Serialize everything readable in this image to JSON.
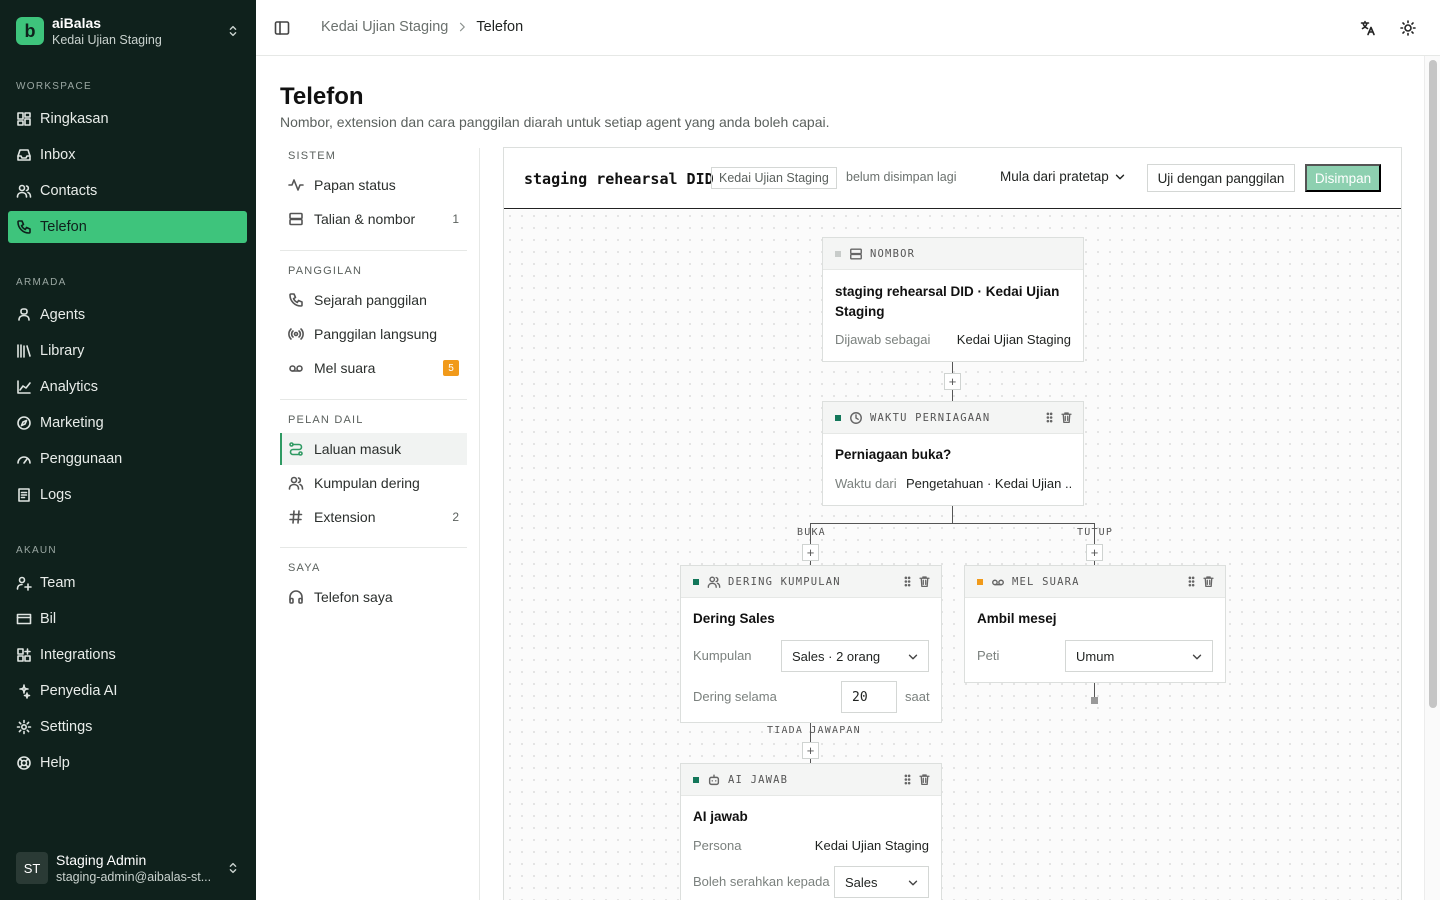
{
  "workspace": {
    "name": "aiBalas",
    "subtitle": "Kedai Ujian Staging",
    "logo_letter": "b"
  },
  "sidebar": {
    "sections": [
      {
        "title": "WORKSPACE",
        "items": [
          {
            "label": "Ringkasan",
            "icon": "dashboard-icon"
          },
          {
            "label": "Inbox",
            "icon": "inbox-icon"
          },
          {
            "label": "Contacts",
            "icon": "users-icon"
          },
          {
            "label": "Telefon",
            "icon": "phone-icon",
            "active": true
          }
        ]
      },
      {
        "title": "ARMADA",
        "items": [
          {
            "label": "Agents",
            "icon": "user-icon"
          },
          {
            "label": "Library",
            "icon": "library-icon"
          },
          {
            "label": "Analytics",
            "icon": "chart-icon"
          },
          {
            "label": "Marketing",
            "icon": "compass-icon"
          },
          {
            "label": "Penggunaan",
            "icon": "gauge-icon"
          },
          {
            "label": "Logs",
            "icon": "logs-icon"
          }
        ]
      },
      {
        "title": "AKAUN",
        "items": [
          {
            "label": "Team",
            "icon": "team-icon"
          },
          {
            "label": "Bil",
            "icon": "card-icon"
          },
          {
            "label": "Integrations",
            "icon": "puzzle-icon"
          },
          {
            "label": "Penyedia AI",
            "icon": "sparkle-icon"
          },
          {
            "label": "Settings",
            "icon": "gear-icon"
          },
          {
            "label": "Help",
            "icon": "lifebuoy-icon"
          }
        ]
      }
    ],
    "user": {
      "initials": "ST",
      "name": "Staging Admin",
      "email": "staging-admin@aibalas-st..."
    }
  },
  "topbar": {
    "crumb_parent": "Kedai Ujian Staging",
    "crumb_current": "Telefon"
  },
  "page": {
    "title": "Telefon",
    "subtitle": "Nombor, extension dan cara panggilan diarah untuk setiap agent yang anda boleh capai."
  },
  "subnav": {
    "sections": [
      {
        "title": "SISTEM",
        "items": [
          {
            "label": "Papan status",
            "icon": "activity-icon",
            "count": ""
          },
          {
            "label": "Talian & nombor",
            "icon": "server-icon",
            "count": "1"
          }
        ]
      },
      {
        "title": "PANGGILAN",
        "items": [
          {
            "label": "Sejarah panggilan",
            "icon": "phone-icon",
            "count": ""
          },
          {
            "label": "Panggilan langsung",
            "icon": "broadcast-icon",
            "count": ""
          },
          {
            "label": "Mel suara",
            "icon": "voicemail-icon",
            "badge": "5"
          }
        ]
      },
      {
        "title": "PELAN DAIL",
        "items": [
          {
            "label": "Laluan masuk",
            "icon": "route-icon",
            "active": true,
            "count": ""
          },
          {
            "label": "Kumpulan dering",
            "icon": "users-icon",
            "count": ""
          },
          {
            "label": "Extension",
            "icon": "hash-icon",
            "count": "2"
          }
        ]
      },
      {
        "title": "SAYA",
        "items": [
          {
            "label": "Telefon saya",
            "icon": "headphones-icon",
            "count": ""
          }
        ]
      }
    ]
  },
  "editor": {
    "title": "staging rehearsal DID",
    "tag": "Kedai Ujian Staging",
    "status": "belum disimpan lagi",
    "start_label": "Mula dari pratetap",
    "test_label": "Uji dengan panggilan",
    "save_label": "Disimpan"
  },
  "nodes": {
    "number": {
      "type": "NOMBOR",
      "title": "staging rehearsal DID · Kedai Ujian Staging",
      "row_label": "Dijawab sebagai",
      "row_value": "Kedai Ujian Staging"
    },
    "hours": {
      "type": "WAKTU PERNIAGAAN",
      "title": "Perniagaan buka?",
      "row_label": "Waktu dari",
      "row_value": "Pengetahuan · Kedai Ujian ..."
    },
    "ring": {
      "type": "DERING KUMPULAN",
      "title": "Dering Sales",
      "group_label": "Kumpulan",
      "group_value": "Sales · 2 orang",
      "ring_label": "Dering selama",
      "ring_value": "20",
      "ring_unit": "saat"
    },
    "voicemail": {
      "type": "MEL SUARA",
      "title": "Ambil mesej",
      "box_label": "Peti",
      "box_value": "Umum"
    },
    "ai": {
      "type": "AI JAWAB",
      "title": "AI jawab",
      "persona_label": "Persona",
      "persona_value": "Kedai Ujian Staging",
      "handoff_label": "Boleh serahkan kepada",
      "handoff_value": "Sales"
    }
  },
  "edges": {
    "open": "BUKA",
    "closed": "TUTUP",
    "no_answer": "TIADA JAWAPAN",
    "add": "+"
  },
  "colors": {
    "sidebar_bg": "#0f211c",
    "accent": "#3ec47c",
    "dot_green": "#13775a",
    "dot_orange": "#f19a1a",
    "save_disabled": "#8dd0b0"
  }
}
